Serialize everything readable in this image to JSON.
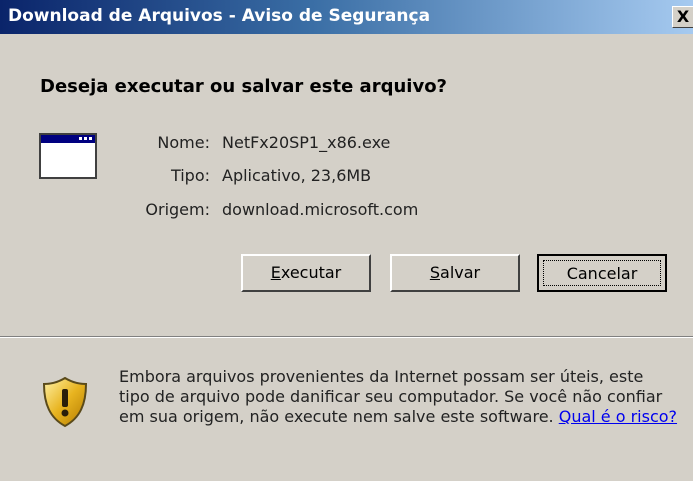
{
  "window": {
    "title": "Download de Arquivos - Aviso de Segurança",
    "close_label": "X"
  },
  "dialog": {
    "question": "Deseja executar ou salvar este arquivo?",
    "icon": "application-window-icon",
    "fields": {
      "name_label": "Nome:",
      "name_value": "NetFx20SP1_x86.exe",
      "type_label": "Tipo:",
      "type_value": "Aplicativo, 23,6MB",
      "origin_label": "Origem:",
      "origin_value": "download.microsoft.com"
    },
    "buttons": {
      "run_hotkey": "E",
      "run_rest": "xecutar",
      "save_hotkey": "S",
      "save_rest": "alvar",
      "cancel_label": "Cancelar"
    }
  },
  "warning": {
    "icon": "security-shield-icon",
    "text": "Embora arquivos provenientes da Internet possam ser úteis, este tipo de arquivo pode danificar seu computador. Se você não confiar em sua origem, não execute nem salve este software.",
    "link_text": "Qual é o risco?"
  },
  "colors": {
    "title_gradient_start": "#0a246a",
    "title_gradient_end": "#a6caf0",
    "face": "#d4d0c8",
    "link": "#0000ee",
    "shield_gold": "#e8b420"
  }
}
